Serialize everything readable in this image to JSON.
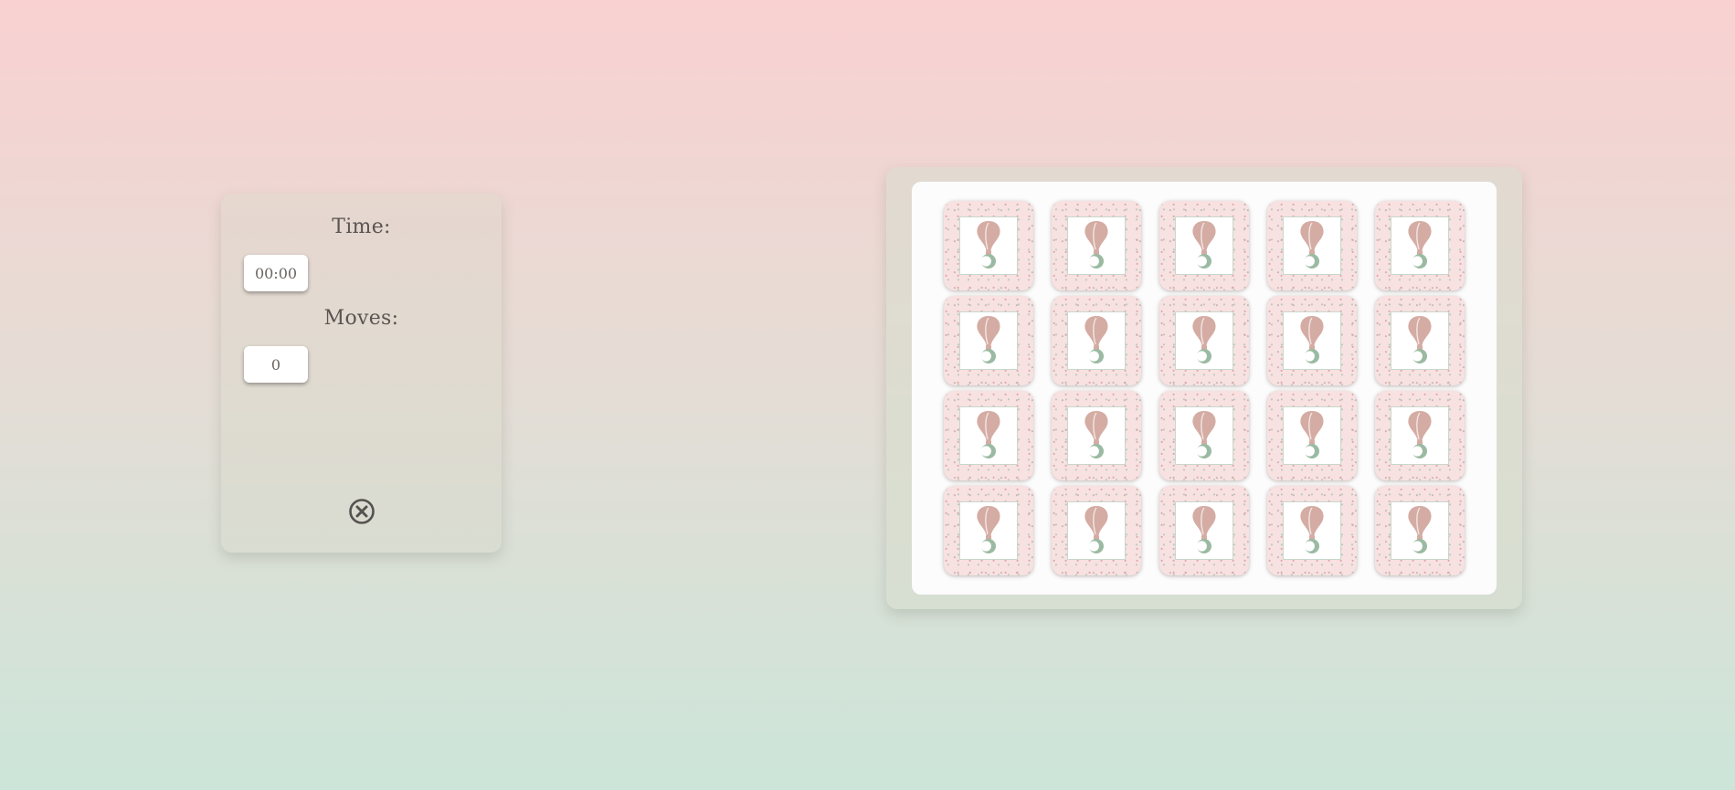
{
  "stats": {
    "time_label": "Time:",
    "time_value": "00:00",
    "moves_label": "Moves:",
    "moves_value": "0",
    "reset_icon": "close-circle-icon"
  },
  "board": {
    "rows": 4,
    "columns": 5,
    "card_back_icon": "hot-air-balloon-icon",
    "face_down": true,
    "colors": {
      "card_back": "#f8e1e1",
      "balloon": "#d4aca3",
      "moon": "#9bbaa2"
    }
  }
}
